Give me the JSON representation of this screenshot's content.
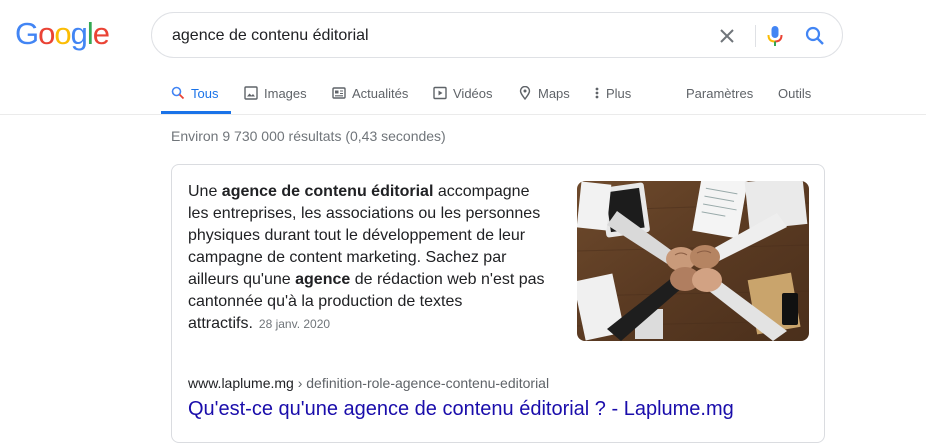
{
  "logo": {
    "text": "Google",
    "colors": [
      "#4285F4",
      "#EA4335",
      "#FBBC05",
      "#4285F4",
      "#34A853",
      "#EA4335"
    ]
  },
  "search": {
    "query": "agence de contenu éditorial"
  },
  "icons": {
    "clear": "close-icon",
    "mic": "microphone-icon",
    "search": "search-icon"
  },
  "tabs": [
    {
      "label": "Tous",
      "icon": "search-icon",
      "active": true
    },
    {
      "label": "Images",
      "icon": "image-icon"
    },
    {
      "label": "Actualités",
      "icon": "news-icon"
    },
    {
      "label": "Vidéos",
      "icon": "play-icon"
    },
    {
      "label": "Maps",
      "icon": "map-pin-icon"
    },
    {
      "label": "Plus",
      "icon": "more-vert-icon"
    }
  ],
  "tools": {
    "settings": "Paramètres",
    "tools": "Outils"
  },
  "stats": "Environ 9 730 000 résultats (0,43 secondes)",
  "featured": {
    "snippet": {
      "t1": "Une ",
      "b1": "agence de contenu éditorial",
      "t2": " accompagne les entreprises, les associations ou les personnes physiques durant tout le développement de leur campagne de content marketing. Sachez par ailleurs qu'une ",
      "b2": "agence",
      "t3": " de rédaction web n'est pas cantonnée qu'à la production de textes attractifs.",
      "date": "28 janv. 2020"
    },
    "image_alt": "hands joining over desk",
    "cite_domain": "www.laplume.mg",
    "cite_path": " › definition-role-agence-contenu-editorial",
    "title": "Qu'est-ce qu'une agence de contenu éditorial ? - Laplume.mg"
  },
  "colors": {
    "accent": "#1a73e8",
    "link": "#1a0dab"
  }
}
